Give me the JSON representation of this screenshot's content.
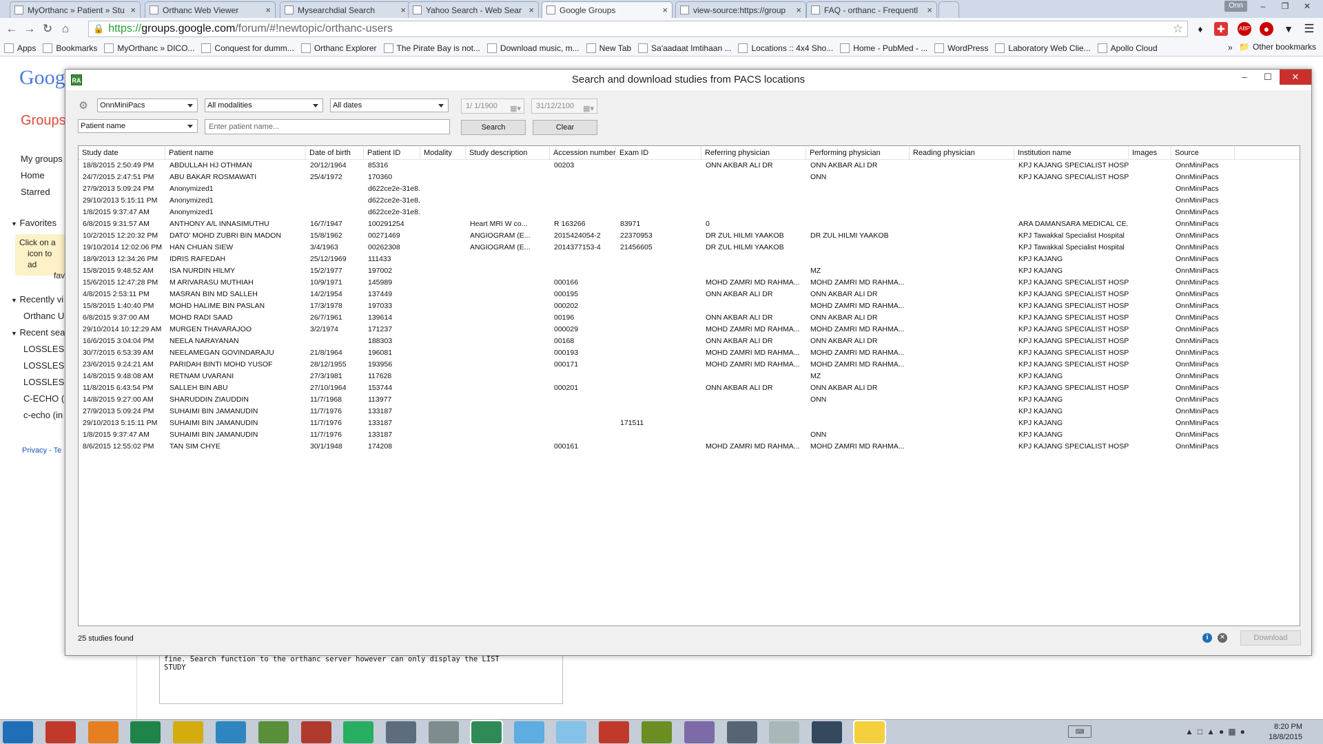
{
  "browser": {
    "tabs": [
      {
        "title": "MyOrthanc » Patient » Stu",
        "active": false
      },
      {
        "title": "Orthanc Web Viewer",
        "active": false
      },
      {
        "title": "Mysearchdial Search",
        "active": false
      },
      {
        "title": "Yahoo Search - Web Sear",
        "active": false
      },
      {
        "title": "Google Groups",
        "active": true
      },
      {
        "title": "view-source:https://group",
        "active": false
      },
      {
        "title": "FAQ - orthanc - Frequentl",
        "active": false
      }
    ],
    "profile_name": "Onn",
    "url_scheme": "https://",
    "url_host": "groups.google.com",
    "url_path": "/forum/#!newtopic/orthanc-users",
    "bookmarks": [
      "Apps",
      "Bookmarks",
      "MyOrthanc » DICO...",
      "Conquest for dumm...",
      "Orthanc Explorer",
      "The Pirate Bay is not...",
      "Download music, m...",
      "New Tab",
      "Sa'aadaat Imtihaan ...",
      "Locations :: 4x4 Sho...",
      "Home - PubMed - ...",
      "WordPress",
      "Laboratory Web Clie...",
      "Apollo Cloud"
    ],
    "other_bookmarks": "Other bookmarks",
    "overflow": "»",
    "ext_abp": "ABP"
  },
  "groups_page": {
    "logo": "Goog",
    "groups": "Groups",
    "nav": [
      "My groups",
      "Home",
      "Starred"
    ],
    "favorites": "Favorites",
    "fav_hint": [
      "Click on a",
      "icon to ad",
      "favo"
    ],
    "recently": "Recently vi",
    "recent_item": "Orthanc U",
    "recent_search": "Recent sea",
    "searches": [
      "LOSSLES",
      "LOSSLES",
      "LOSSLES",
      "C-ECHO (i",
      "c-echo (in"
    ],
    "footer": "Privacy - Te",
    "textarea_lines": "fine. Search function to the orthanc server however can only display the LIST\nSTUDY"
  },
  "dialog": {
    "title": "Search and download studies from PACS locations",
    "icon_label": "RA",
    "controls": {
      "location": "OnnMiniPacs",
      "modalities": "All modalities",
      "dates": "All dates",
      "date_from": "1/  1/1900",
      "date_to": "31/12/2100",
      "field": "Patient name",
      "search_placeholder": "Enter patient name...",
      "search_btn": "Search",
      "clear_btn": "Clear"
    },
    "columns": [
      "Study date",
      "Patient name",
      "Date of birth",
      "Patient ID",
      "Modality",
      "Study description",
      "Accession number",
      "Exam ID",
      "Referring physician",
      "Performing physician",
      "Reading physician",
      "Institution name",
      "Images",
      "Source"
    ],
    "rows": [
      [
        "18/8/2015 2:50:49 PM",
        "ABDULLAH HJ OTHMAN",
        "20/12/1964",
        "85316",
        "",
        "",
        "00203",
        "",
        "ONN AKBAR ALI  DR",
        "ONN AKBAR ALI  DR",
        "",
        "KPJ KAJANG SPECIALIST HOSPI...",
        "",
        "OnnMiniPacs"
      ],
      [
        "24/7/2015 2:47:51 PM",
        "ABU BAKAR ROSMAWATI",
        "25/4/1972",
        "170360",
        "",
        "",
        "",
        "",
        "",
        "ONN",
        "",
        "KPJ KAJANG SPECIALIST HOSPI...",
        "",
        "OnnMiniPacs"
      ],
      [
        "27/9/2013 5:09:24 PM",
        "Anonymized1",
        "",
        "d622ce2e-31e8...",
        "",
        "",
        "",
        "",
        "",
        "",
        "",
        "",
        "",
        "OnnMiniPacs"
      ],
      [
        "29/10/2013 5:15:11 PM",
        "Anonymized1",
        "",
        "d622ce2e-31e8...",
        "",
        "",
        "",
        "",
        "",
        "",
        "",
        "",
        "",
        "OnnMiniPacs"
      ],
      [
        "1/8/2015 9:37:47 AM",
        "Anonymized1",
        "",
        "d622ce2e-31e8...",
        "",
        "",
        "",
        "",
        "",
        "",
        "",
        "",
        "",
        "OnnMiniPacs"
      ],
      [
        "6/8/2015 9:31:57 AM",
        "ANTHONY A/L INNASIMUTHU",
        "16/7/1947",
        "100291254",
        "",
        "Heart MRI W co...",
        "R 163266",
        "83971",
        "0",
        "",
        "",
        "ARA DAMANSARA MEDICAL CE...",
        "",
        "OnnMiniPacs"
      ],
      [
        "10/2/2015 12:20:32 PM",
        "DATO' MOHD ZUBRI BIN MADON",
        "15/8/1962",
        "00271469",
        "",
        "ANGIOGRAM (E...",
        "2015424054-2",
        "22370953",
        "DR ZUL HILMI YAAKOB",
        "DR ZUL HILMI YAAKOB",
        "",
        "KPJ Tawakkal Specialist  Hospital",
        "",
        "OnnMiniPacs"
      ],
      [
        "19/10/2014 12:02:06 PM",
        "HAN CHUAN SIEW",
        "3/4/1963",
        "00262308",
        "",
        "ANGIOGRAM (E...",
        "2014377153-4",
        "21456605",
        "DR ZUL HILMI YAAKOB",
        "",
        "",
        "KPJ Tawakkal Specialist  Hospital",
        "",
        "OnnMiniPacs"
      ],
      [
        "18/9/2013 12:34:26 PM",
        "IDRIS RAFEDAH",
        "25/12/1969",
        "111433",
        "",
        "",
        "",
        "",
        "",
        "",
        "",
        "KPJ KAJANG",
        "",
        "OnnMiniPacs"
      ],
      [
        "15/8/2015 9:48:52 AM",
        "ISA NURDIN HILMY",
        "15/2/1977",
        "197002",
        "",
        "",
        "",
        "",
        "",
        "MZ",
        "",
        "KPJ KAJANG",
        "",
        "OnnMiniPacs"
      ],
      [
        "15/6/2015 12:47:28 PM",
        "M ARIVARASU MUTHIAH",
        "10/9/1971",
        "145989",
        "",
        "",
        "000166",
        "",
        "MOHD ZAMRI MD RAHMA...",
        "MOHD ZAMRI MD RAHMA...",
        "",
        "KPJ KAJANG SPECIALIST HOSPI...",
        "",
        "OnnMiniPacs"
      ],
      [
        "4/8/2015 2:53:11 PM",
        "MASRAN BIN MD SALLEH",
        "14/2/1954",
        "137449",
        "",
        "",
        "000195",
        "",
        "ONN AKBAR ALI  DR",
        "ONN AKBAR ALI  DR",
        "",
        "KPJ KAJANG SPECIALIST HOSPI...",
        "",
        "OnnMiniPacs"
      ],
      [
        "15/8/2015 1:40:40 PM",
        "MOHD HALIME BIN  PASLAN",
        "17/3/1978",
        "197033",
        "",
        "",
        "000202",
        "",
        "",
        "MOHD ZAMRI MD RAHMA...",
        "",
        "KPJ KAJANG SPECIALIST HOSPI...",
        "",
        "OnnMiniPacs"
      ],
      [
        "6/8/2015 9:37:00 AM",
        "MOHD RADI SAAD",
        "26/7/1961",
        "139614",
        "",
        "",
        "00196",
        "",
        "ONN AKBAR ALI  DR",
        "ONN AKBAR ALI  DR",
        "",
        "KPJ KAJANG SPECIALIST HOSPI...",
        "",
        "OnnMiniPacs"
      ],
      [
        "29/10/2014 10:12:29 AM",
        "MURGEN THAVARAJOO",
        "3/2/1974",
        "171237",
        "",
        "",
        "000029",
        "",
        "MOHD ZAMRI MD RAHMA...",
        "MOHD ZAMRI MD RAHMA...",
        "",
        "KPJ KAJANG SPECIALIST HOSPI...",
        "",
        "OnnMiniPacs"
      ],
      [
        "16/6/2015 3:04:04 PM",
        "NEELA NARAYANAN",
        "",
        "188303",
        "",
        "",
        "00168",
        "",
        "ONN AKBAR ALI  DR",
        "ONN AKBAR ALI  DR",
        "",
        "KPJ KAJANG SPECIALIST HOSPI...",
        "",
        "OnnMiniPacs"
      ],
      [
        "30/7/2015 6:53:39 AM",
        "NEELAMEGAN GOVINDARAJU",
        "21/8/1964",
        "196081",
        "",
        "",
        "000193",
        "",
        "MOHD ZAMRI MD RAHMA...",
        "MOHD ZAMRI MD RAHMA...",
        "",
        "KPJ KAJANG SPECIALIST HOSPI...",
        "",
        "OnnMiniPacs"
      ],
      [
        "23/6/2015 9:24:21 AM",
        "PARIDAH BINTI MOHD YUSOF",
        "28/12/1955",
        "193956",
        "",
        "",
        "000171",
        "",
        "MOHD ZAMRI MD RAHMA...",
        "MOHD ZAMRI MD RAHMA...",
        "",
        "KPJ KAJANG SPECIALIST HOSPI...",
        "",
        "OnnMiniPacs"
      ],
      [
        "14/8/2015 9:48:08 AM",
        "RETNAM UVARANI",
        "27/3/1981",
        "117628",
        "",
        "",
        "",
        "",
        "",
        "MZ",
        "",
        "KPJ KAJANG",
        "",
        "OnnMiniPacs"
      ],
      [
        "11/8/2015 6:43:54 PM",
        "SALLEH BIN ABU",
        "27/10/1964",
        "153744",
        "",
        "",
        "000201",
        "",
        "ONN AKBAR ALI  DR",
        "ONN AKBAR ALI  DR",
        "",
        "KPJ KAJANG SPECIALIST HOSPI...",
        "",
        "OnnMiniPacs"
      ],
      [
        "14/8/2015 9:27:00 AM",
        "SHARUDDIN ZIAUDDIN",
        "11/7/1968",
        "113977",
        "",
        "",
        "",
        "",
        "",
        "ONN",
        "",
        "KPJ KAJANG",
        "",
        "OnnMiniPacs"
      ],
      [
        "27/9/2013 5:09:24 PM",
        "SUHAIMI BIN JAMANUDIN",
        "11/7/1976",
        "133187",
        "",
        "",
        "",
        "",
        "",
        "",
        "",
        "KPJ KAJANG",
        "",
        "OnnMiniPacs"
      ],
      [
        "29/10/2013 5:15:11 PM",
        "SUHAIMI BIN JAMANUDIN",
        "11/7/1976",
        "133187",
        "",
        "",
        "",
        "171511",
        "",
        "",
        "",
        "KPJ KAJANG",
        "",
        "OnnMiniPacs"
      ],
      [
        "1/8/2015 9:37:47 AM",
        "SUHAIMI BIN JAMANUDIN",
        "11/7/1976",
        "133187",
        "",
        "",
        "",
        "",
        "",
        "ONN",
        "",
        "KPJ KAJANG",
        "",
        "OnnMiniPacs"
      ],
      [
        "8/6/2015 12:55:02 PM",
        "TAN SIM CHYE",
        "30/1/1948",
        "174208",
        "",
        "",
        "000161",
        "",
        "MOHD ZAMRI MD RAHMA...",
        "MOHD ZAMRI MD RAHMA...",
        "",
        "KPJ KAJANG SPECIALIST HOSPI...",
        "",
        "OnnMiniPacs"
      ]
    ],
    "status": "25 studies found",
    "download_btn": "Download"
  },
  "taskbar": {
    "apps": [
      "windows-start",
      "powerpoint",
      "firefox",
      "excel",
      "file-explorer",
      "internet-explorer",
      "evernote",
      "filezilla",
      "chrome",
      "remote-desktop",
      "utility",
      "radiant",
      "explorer",
      "notepad",
      "acrobat",
      "grammarly",
      "waveform",
      "settings",
      "paint",
      "media",
      "notes"
    ],
    "time": "8:20 PM",
    "date": "18/8/2015"
  },
  "colors": {
    "close": "#c9302c",
    "groups_red": "#dd4b39",
    "accent_blue": "#1e6fb8"
  }
}
